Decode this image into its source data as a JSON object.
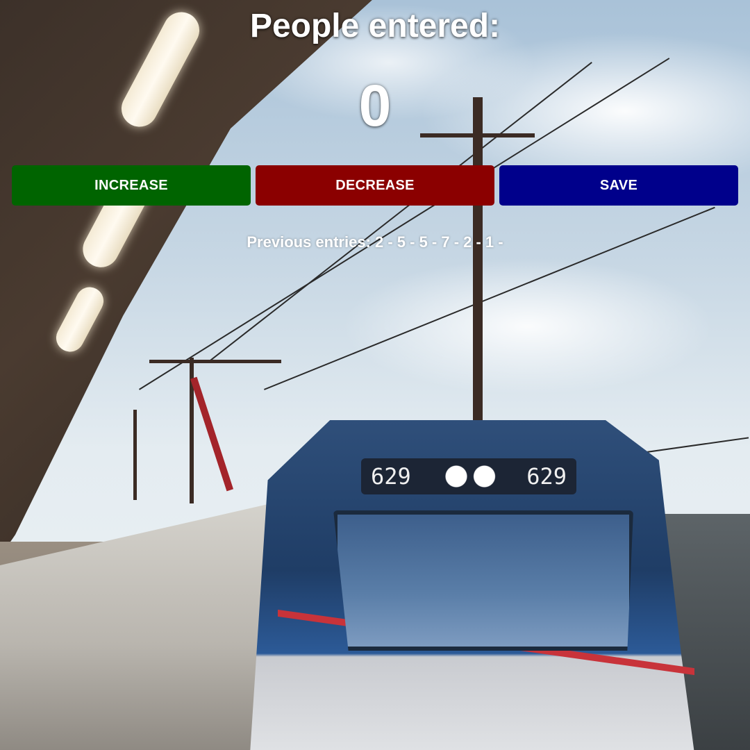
{
  "app": {
    "title": "People entered:",
    "count": "0"
  },
  "buttons": {
    "increase_label": "INCREASE",
    "decrease_label": "DECREASE",
    "save_label": "SAVE"
  },
  "previous_entries": {
    "text": "Previous entries: 2 - 5 - 5 - 7 - 2 - 1 -"
  },
  "background": {
    "headboard_left": "629",
    "headboard_right": "629"
  },
  "colors": {
    "increase": "#006400",
    "decrease": "#8b0000",
    "save": "#00008b",
    "text": "#ffffff"
  }
}
